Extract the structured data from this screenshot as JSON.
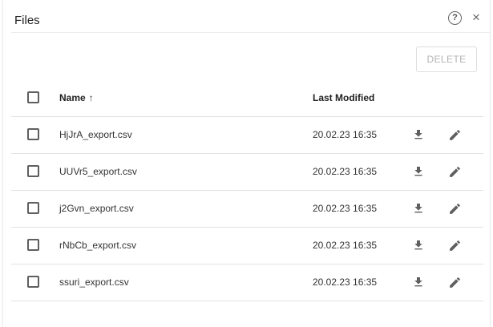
{
  "dialog": {
    "title": "Files",
    "help_icon": "help-circle-icon",
    "close_icon": "close-icon",
    "close_glyph": "×",
    "help_glyph": "?"
  },
  "toolbar": {
    "delete_label": "DELETE"
  },
  "table": {
    "columns": {
      "name": "Name",
      "last_modified": "Last Modified"
    },
    "sort": {
      "column": "name",
      "direction": "asc",
      "icon": "arrow-up-icon",
      "glyph": "↑"
    },
    "rows": [
      {
        "name": "HjJrA_export.csv",
        "modified": "20.02.23 16:35"
      },
      {
        "name": "UUVr5_export.csv",
        "modified": "20.02.23 16:35"
      },
      {
        "name": "j2Gvn_export.csv",
        "modified": "20.02.23 16:35"
      },
      {
        "name": "rNbCb_export.csv",
        "modified": "20.02.23 16:35"
      },
      {
        "name": "ssuri_export.csv",
        "modified": "20.02.23 16:35"
      }
    ],
    "row_icons": [
      "download-icon",
      "edit-pencil-icon"
    ]
  },
  "colors": {
    "disabled_text": "#b3b3b3",
    "divider": "#e2e2e2",
    "icon": "#5f5f5f"
  }
}
